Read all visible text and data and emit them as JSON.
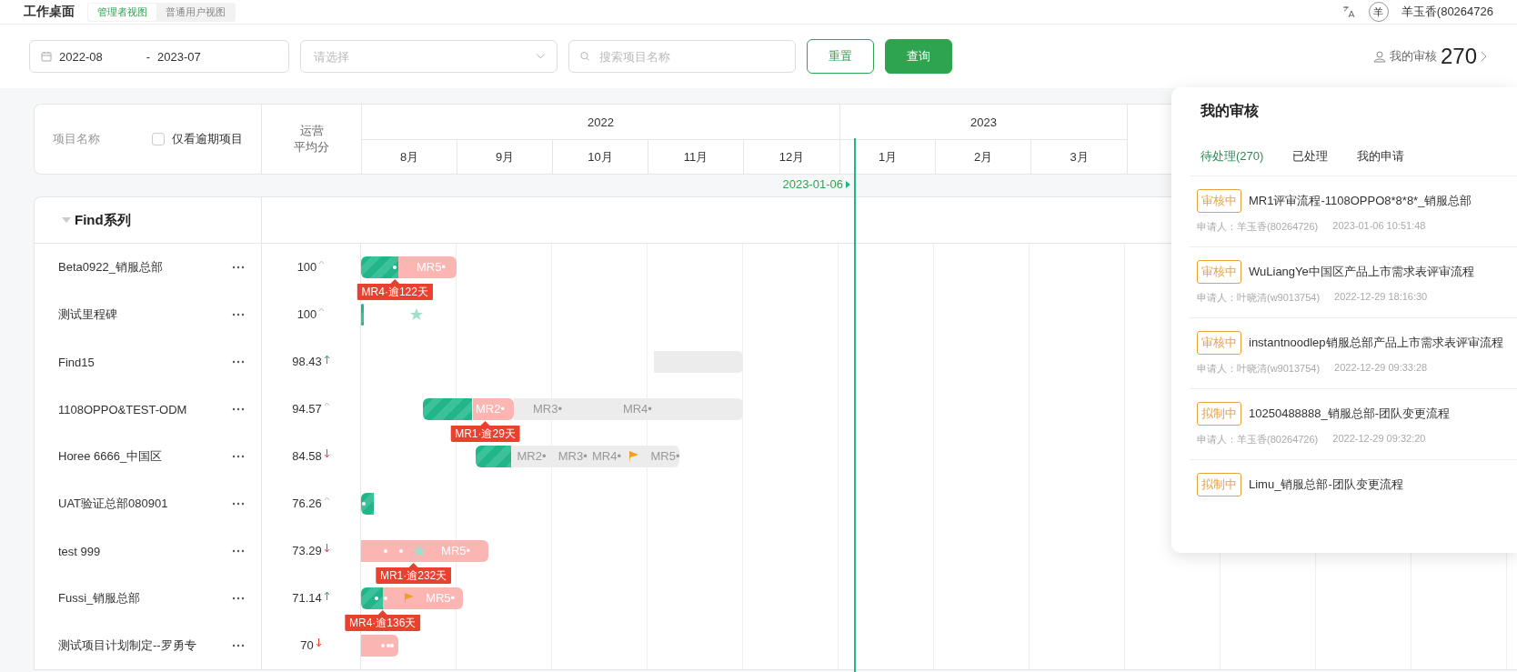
{
  "topbar": {
    "title": "工作桌面",
    "views": [
      {
        "label": "管理者视图",
        "selected": true
      },
      {
        "label": "普通用户视图",
        "selected": false
      }
    ],
    "avatar": "羊",
    "user": "羊玉香(80264726"
  },
  "filters": {
    "date_from": "2022-08",
    "date_sep": "-",
    "date_to": "2023-07",
    "select": {
      "placeholder": "请选择"
    },
    "search": {
      "placeholder": "搜索项目名称"
    },
    "buttons": [
      {
        "label": "重置",
        "kind": "outline"
      },
      {
        "label": "查询",
        "kind": "primary"
      }
    ],
    "review_link": {
      "label": "我的审核",
      "count": "270"
    }
  },
  "gantt": {
    "header": {
      "name_col": "项目名称",
      "overdue_only": {
        "label": "仅看逾期项目",
        "checked": false
      },
      "score_col": [
        "运营",
        "平均分"
      ]
    },
    "years": [
      {
        "year": "2022",
        "months": [
          "8月",
          "9月",
          "10月",
          "11月",
          "12月"
        ]
      },
      {
        "year": "2023",
        "months": [
          "1月",
          "2月",
          "3月"
        ]
      }
    ],
    "today": {
      "label": "2023-01-06"
    },
    "groups": [
      {
        "name": "Find系列",
        "expanded": true,
        "rows": [
          {
            "name": "Beta0922_销服总部",
            "score": "100",
            "kind": "flat",
            "segments": [
              {
                "kind": "done"
              },
              {
                "kind": "late"
              }
            ],
            "marks": [
              {
                "kind": "dot"
              }
            ],
            "labels": [
              {
                "text": "MR5•",
                "kind": "late"
              }
            ],
            "tag": {
              "text": "MR4·逾122天"
            }
          },
          {
            "name": "测试里程碑",
            "score": "100",
            "kind": "flat",
            "segments": [
              {
                "kind": "done"
              }
            ],
            "marks": [
              {
                "kind": "star"
              }
            ]
          },
          {
            "name": "Find15",
            "score": "98.43",
            "kind": "up",
            "segments": [
              {
                "kind": "plan"
              }
            ]
          },
          {
            "name": "1108OPPO&TEST-ODM",
            "score": "94.57",
            "kind": "flat",
            "segments": [
              {
                "kind": "done"
              },
              {
                "kind": "late"
              },
              {
                "kind": "plan"
              }
            ],
            "labels": [
              {
                "text": "MR2•",
                "kind": "late"
              },
              {
                "text": "MR3•",
                "kind": "plan"
              },
              {
                "text": "MR4•",
                "kind": "plan"
              }
            ],
            "tag": {
              "text": "MR1·逾29天"
            }
          },
          {
            "name": "Horee 6666_中国区",
            "score": "84.58",
            "kind": "down",
            "segments": [
              {
                "kind": "done"
              },
              {
                "kind": "plan"
              }
            ],
            "marks": [
              {
                "kind": "flag"
              }
            ],
            "labels": [
              {
                "text": "MR2•",
                "kind": "plan"
              },
              {
                "text": "MR3•",
                "kind": "plan"
              },
              {
                "text": "MR4•",
                "kind": "plan"
              },
              {
                "text": "MR5•",
                "kind": "plan"
              }
            ]
          },
          {
            "name": "UAT验证总部080901",
            "score": "76.26",
            "kind": "flat",
            "segments": [
              {
                "kind": "done"
              }
            ],
            "marks": [
              {
                "kind": "dot"
              }
            ]
          },
          {
            "name": "test 999",
            "score": "73.29",
            "kind": "down",
            "segments": [
              {
                "kind": "late"
              }
            ],
            "marks": [
              {
                "kind": "dot"
              },
              {
                "kind": "dot"
              },
              {
                "kind": "star"
              }
            ],
            "labels": [
              {
                "text": "MR5•",
                "kind": "late"
              }
            ],
            "tag": {
              "text": "MR1·逾232天"
            }
          },
          {
            "name": "Fussi_销服总部",
            "score": "71.14",
            "kind": "up",
            "segments": [
              {
                "kind": "done"
              },
              {
                "kind": "late"
              }
            ],
            "marks": [
              {
                "kind": "dot"
              },
              {
                "kind": "dot"
              },
              {
                "kind": "flag"
              }
            ],
            "labels": [
              {
                "text": "MR5•",
                "kind": "late"
              }
            ],
            "tag": {
              "text": "MR4·逾136天"
            }
          },
          {
            "name": "测试项目计划制定--罗勇专",
            "score": "70",
            "kind": "down",
            "segments": [
              {
                "kind": "late"
              }
            ],
            "marks": [
              {
                "kind": "dot"
              },
              {
                "kind": "dot"
              },
              {
                "kind": "dot"
              }
            ]
          }
        ]
      }
    ]
  },
  "review": {
    "title": "我的审核",
    "tabs": [
      {
        "label": "待处理(270)",
        "selected": true
      },
      {
        "label": "已处理",
        "selected": false
      },
      {
        "label": "我的申请",
        "selected": false
      }
    ],
    "items": [
      {
        "status": "审核中",
        "title": "MR1评审流程-1108OPPO8*8*8*_销服总部",
        "applicant": "申请人：羊玉香(80264726)",
        "time": "2023-01-06 10:51:48"
      },
      {
        "status": "审核中",
        "title": "WuLiangYe中国区产品上市需求表评审流程",
        "applicant": "申请人：叶晓清(w9013754)",
        "time": "2022-12-29 18:16:30"
      },
      {
        "status": "审核中",
        "title": "instantnoodlep销服总部产品上市需求表评审流程",
        "applicant": "申请人：叶晓清(w9013754)",
        "time": "2022-12-29 09:33:28"
      },
      {
        "status": "拟制中",
        "title": "10250488888_销服总部-团队变更流程",
        "applicant": "申请人：羊玉香(80264726)",
        "time": "2022-12-29 09:32:20"
      },
      {
        "status": "拟制中",
        "title": "Limu_销服总部-团队变更流程"
      }
    ]
  }
}
